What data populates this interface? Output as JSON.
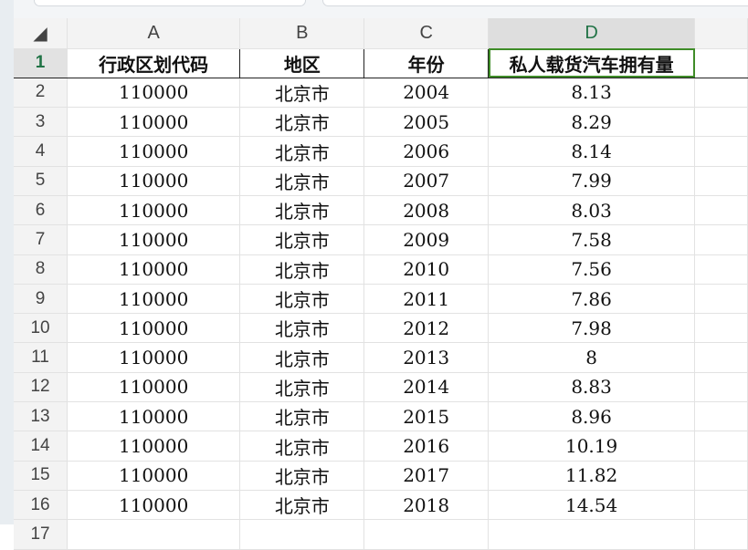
{
  "columns": [
    "A",
    "B",
    "C",
    "D"
  ],
  "header": [
    "行政区划代码",
    "地区",
    "年份",
    "私人载货汽车拥有量"
  ],
  "rows": [
    [
      "110000",
      "北京市",
      "2004",
      "8.13"
    ],
    [
      "110000",
      "北京市",
      "2005",
      "8.29"
    ],
    [
      "110000",
      "北京市",
      "2006",
      "8.14"
    ],
    [
      "110000",
      "北京市",
      "2007",
      "7.99"
    ],
    [
      "110000",
      "北京市",
      "2008",
      "8.03"
    ],
    [
      "110000",
      "北京市",
      "2009",
      "7.58"
    ],
    [
      "110000",
      "北京市",
      "2010",
      "7.56"
    ],
    [
      "110000",
      "北京市",
      "2011",
      "7.86"
    ],
    [
      "110000",
      "北京市",
      "2012",
      "7.98"
    ],
    [
      "110000",
      "北京市",
      "2013",
      "8"
    ],
    [
      "110000",
      "北京市",
      "2014",
      "8.83"
    ],
    [
      "110000",
      "北京市",
      "2015",
      "8.96"
    ],
    [
      "110000",
      "北京市",
      "2016",
      "10.19"
    ],
    [
      "110000",
      "北京市",
      "2017",
      "11.82"
    ],
    [
      "110000",
      "北京市",
      "2018",
      "14.54"
    ]
  ],
  "row_numbers": [
    "1",
    "2",
    "3",
    "4",
    "5",
    "6",
    "7",
    "8",
    "9",
    "10",
    "11",
    "12",
    "13",
    "14",
    "15",
    "16",
    "17"
  ],
  "accent_color": "#3f8c28"
}
